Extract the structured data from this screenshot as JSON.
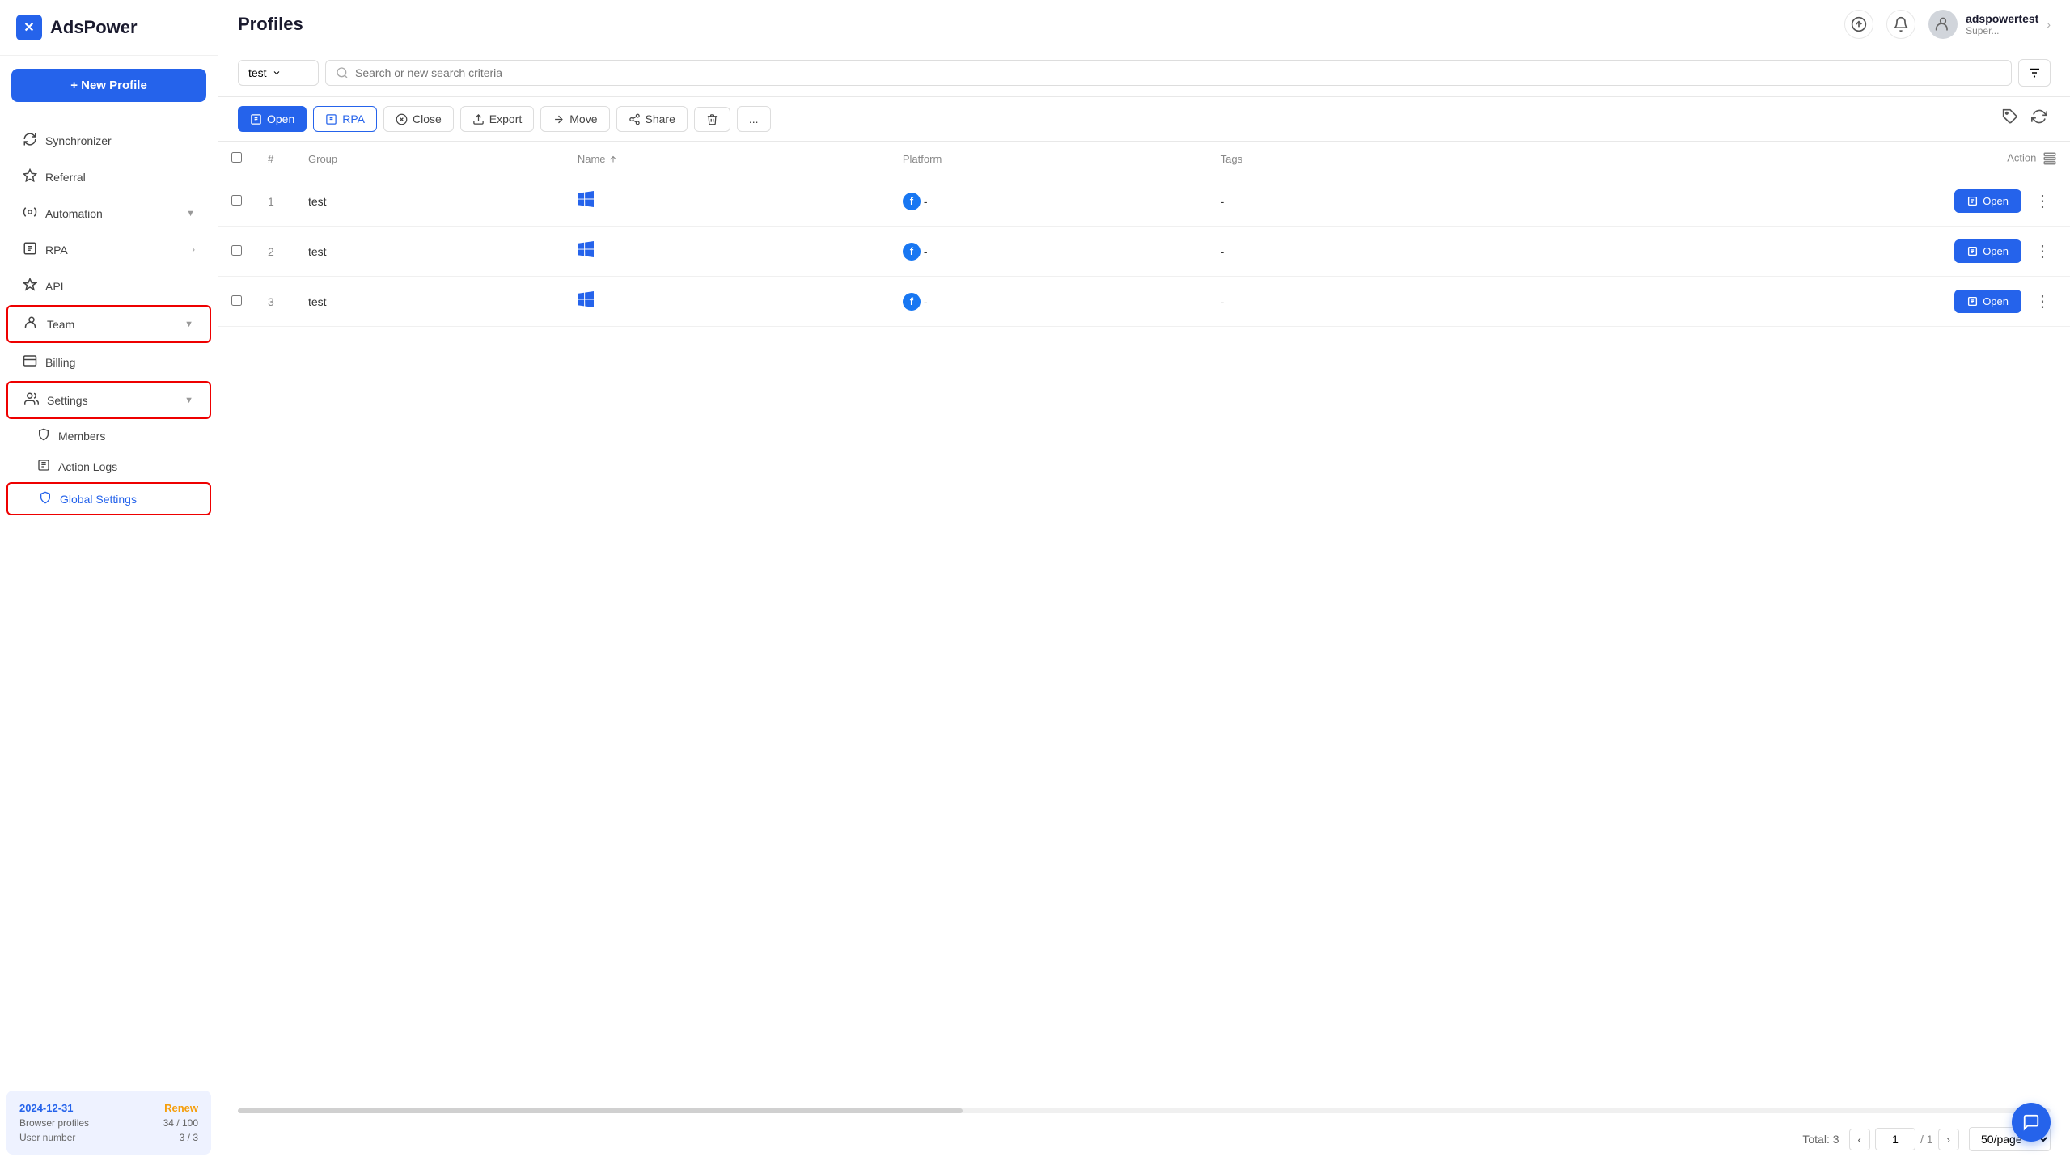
{
  "app": {
    "name": "AdsPower"
  },
  "sidebar": {
    "new_profile_label": "+ New Profile",
    "nav_items": [
      {
        "id": "synchronizer",
        "label": "Synchronizer",
        "icon": "⟳",
        "has_arrow": false
      },
      {
        "id": "referral",
        "label": "Referral",
        "icon": "★",
        "has_arrow": false
      },
      {
        "id": "automation",
        "label": "Automation",
        "icon": "⚙",
        "has_arrow": true
      },
      {
        "id": "rpa",
        "label": "RPA",
        "icon": "▣",
        "has_arrow": true
      },
      {
        "id": "api",
        "label": "API",
        "icon": "⚡",
        "has_arrow": false
      },
      {
        "id": "team",
        "label": "Team",
        "icon": "⚙",
        "has_arrow": true,
        "highlighted": true
      },
      {
        "id": "billing",
        "label": "Billing",
        "icon": "▣",
        "has_arrow": false
      },
      {
        "id": "settings",
        "label": "Settings",
        "icon": "👤",
        "has_arrow": true,
        "highlighted": true
      },
      {
        "id": "members",
        "label": "Members",
        "icon": "🛡",
        "is_sub": true
      },
      {
        "id": "action_logs",
        "label": "Action Logs",
        "icon": "📋",
        "is_sub": true
      },
      {
        "id": "global_settings",
        "label": "Global Settings",
        "icon": "⬡",
        "is_sub": true,
        "highlighted": true
      }
    ],
    "footer": {
      "date": "2024-12-31",
      "renew": "Renew",
      "browser_profiles_label": "Browser profiles",
      "browser_profiles_value": "34 / 100",
      "user_number_label": "User number",
      "user_number_value": "3 / 3"
    }
  },
  "header": {
    "title": "Profiles",
    "user": {
      "name": "adspowertest",
      "role": "Super..."
    }
  },
  "toolbar": {
    "group": "test",
    "group_placeholder": "test",
    "search_placeholder": "Search or new search criteria"
  },
  "actions": {
    "open": "Open",
    "rpa": "RPA",
    "close": "Close",
    "export": "Export",
    "move": "Move",
    "share": "Share",
    "more": "..."
  },
  "table": {
    "columns": [
      "#",
      "Group",
      "Name",
      "Platform",
      "Tags",
      "Action"
    ],
    "rows": [
      {
        "id": 1,
        "group": "test",
        "platform_icon": "windows",
        "platform_label": "fb",
        "tags": "-",
        "action": "Open"
      },
      {
        "id": 2,
        "group": "test",
        "platform_icon": "windows",
        "platform_label": "fb",
        "tags": "-",
        "action": "Open"
      },
      {
        "id": 3,
        "group": "test",
        "platform_icon": "windows",
        "platform_label": "fb",
        "tags": "-",
        "action": "Open"
      }
    ]
  },
  "pagination": {
    "total_label": "Total: 3",
    "current_page": "1",
    "total_pages": "/ 1",
    "per_page": "50/page"
  }
}
